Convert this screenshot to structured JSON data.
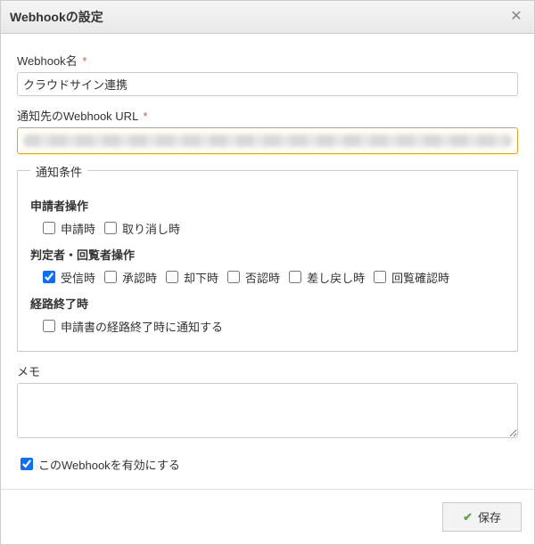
{
  "dialog": {
    "title": "Webhookの設定"
  },
  "fields": {
    "name_label": "Webhook名",
    "name_value": "クラウドサイン連携",
    "url_label": "通知先のWebhook URL",
    "memo_label": "メモ",
    "memo_value": ""
  },
  "conditions": {
    "legend": "通知条件",
    "applicant": {
      "title": "申請者操作",
      "items": [
        {
          "label": "申請時",
          "checked": false
        },
        {
          "label": "取り消し時",
          "checked": false
        }
      ]
    },
    "approver": {
      "title": "判定者・回覧者操作",
      "items": [
        {
          "label": "受信時",
          "checked": true
        },
        {
          "label": "承認時",
          "checked": false
        },
        {
          "label": "却下時",
          "checked": false
        },
        {
          "label": "否認時",
          "checked": false
        },
        {
          "label": "差し戻し時",
          "checked": false
        },
        {
          "label": "回覧確認時",
          "checked": false
        }
      ]
    },
    "route_end": {
      "title": "経路終了時",
      "items": [
        {
          "label": "申請書の経路終了時に通知する",
          "checked": false
        }
      ]
    }
  },
  "enable": {
    "label": "このWebhookを有効にする",
    "checked": true
  },
  "footer": {
    "save_label": "保存"
  }
}
